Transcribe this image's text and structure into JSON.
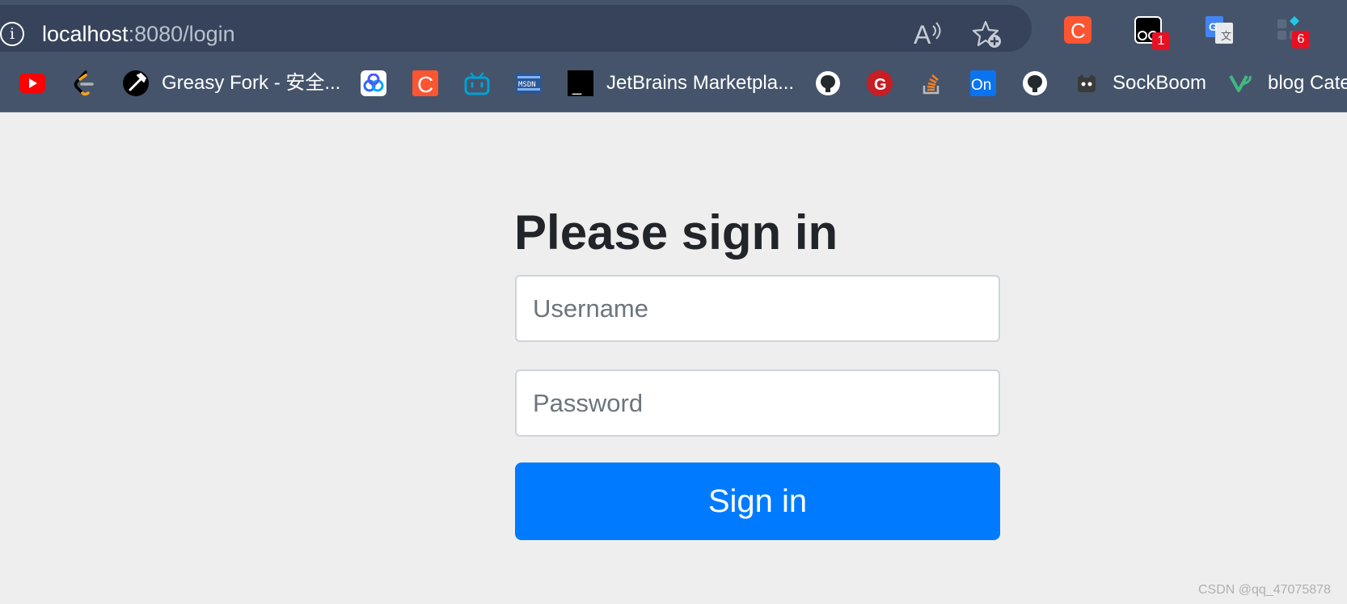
{
  "address_bar": {
    "url_host": "localhost",
    "url_rest": ":8080/login"
  },
  "extensions": [
    {
      "name": "csdn-extension",
      "letter": "C",
      "color": "#fc5531"
    },
    {
      "name": "tampermonkey-extension",
      "badge": "1"
    },
    {
      "name": "google-translate-extension"
    },
    {
      "name": "extensions-menu",
      "badge": "6"
    }
  ],
  "bookmarks": [
    {
      "name": "youtube",
      "label": ""
    },
    {
      "name": "leetcode",
      "label": ""
    },
    {
      "name": "greasy-fork",
      "label": "Greasy Fork - 安全..."
    },
    {
      "name": "baidu-netdisk",
      "label": ""
    },
    {
      "name": "csdn",
      "label": ""
    },
    {
      "name": "bilibili",
      "label": ""
    },
    {
      "name": "msdn",
      "label": ""
    },
    {
      "name": "jetbrains-marketplace",
      "label": "JetBrains Marketpla..."
    },
    {
      "name": "github",
      "label": ""
    },
    {
      "name": "gitee",
      "label": ""
    },
    {
      "name": "stackoverflow",
      "label": ""
    },
    {
      "name": "on",
      "label": ""
    },
    {
      "name": "github-2",
      "label": ""
    },
    {
      "name": "sockboom",
      "label": "SockBoom"
    },
    {
      "name": "vue-blog",
      "label": "blog Cate"
    }
  ],
  "icon_text": {
    "csdn_letter": "C",
    "on_text": "On",
    "gitee_letter": "G",
    "terminal_text": "_",
    "msdn_text": "MSDN"
  },
  "login": {
    "title": "Please sign in",
    "username_placeholder": "Username",
    "password_placeholder": "Password",
    "submit_label": "Sign in"
  },
  "watermark": "CSDN @qq_47075878",
  "colors": {
    "chrome_bg": "#45546b",
    "address_bg": "#36435a",
    "page_bg": "#eeeeee",
    "primary": "#007bff",
    "title_text": "#212529"
  }
}
